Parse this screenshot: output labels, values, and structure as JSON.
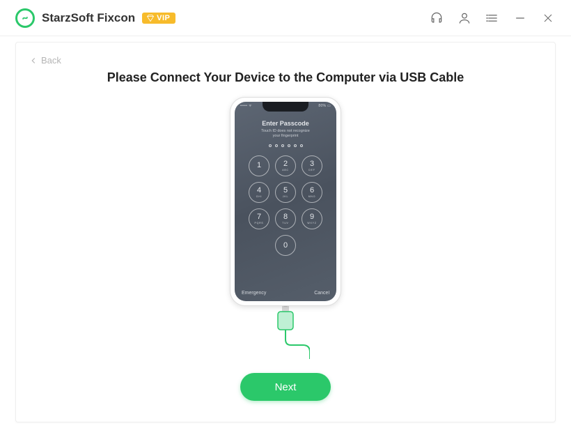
{
  "header": {
    "app_title": "StarzSoft Fixcon",
    "vip_label": "VIP"
  },
  "nav": {
    "back_label": "Back"
  },
  "main": {
    "instruction": "Please Connect Your Device to the Computer via USB Cable",
    "next_label": "Next"
  },
  "phone": {
    "status_left": "••••• ᯤ",
    "status_right": "80% ▭",
    "title": "Enter Passcode",
    "subtitle_line1": "Touch ID does not recognize",
    "subtitle_line2": "your fingerprint",
    "keys": [
      {
        "n": "1",
        "l": ""
      },
      {
        "n": "2",
        "l": "ABC"
      },
      {
        "n": "3",
        "l": "DEF"
      },
      {
        "n": "4",
        "l": "GHI"
      },
      {
        "n": "5",
        "l": "JKL"
      },
      {
        "n": "6",
        "l": "MNO"
      },
      {
        "n": "7",
        "l": "PQRS"
      },
      {
        "n": "8",
        "l": "TUV"
      },
      {
        "n": "9",
        "l": "WXYZ"
      },
      {
        "n": "0",
        "l": ""
      }
    ],
    "emergency": "Emergency",
    "cancel": "Cancel"
  },
  "colors": {
    "accent": "#2bc86a",
    "vip": "#f7bb2b"
  }
}
